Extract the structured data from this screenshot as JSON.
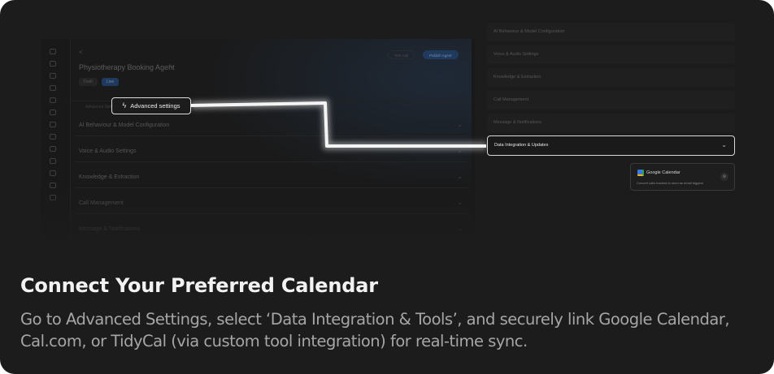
{
  "caption": {
    "title": "Connect Your Preferred Calendar",
    "body": "Go to Advanced Settings, select ‘Data Integration & Tools’, and securely link Google Calendar, Cal.com, or TidyCal (via custom tool integration) for real-time sync."
  },
  "app": {
    "back_label": "<",
    "agent_title": "Physiotherapy Booking Agent",
    "edit_icon": "pencil-icon",
    "tabs": [
      {
        "label": "Draft"
      },
      {
        "label": "Live"
      }
    ],
    "header_buttons": [
      {
        "label": "Test Call"
      },
      {
        "label": "Publish Agent"
      }
    ],
    "advanced_row_label": "Advanced Settings",
    "rail_icons": [
      "home-icon",
      "grid-icon",
      "agents-icon",
      "phone-icon",
      "chart-icon",
      "filter-icon",
      "globe-icon",
      "bolt-icon",
      "phone-call-icon",
      "plus-icon",
      "card-icon",
      "doc-icon",
      "settings-icon"
    ],
    "left_items": [
      {
        "label": "AI Behaviour & Model Configuration"
      },
      {
        "label": "Voice & Audio Settings"
      },
      {
        "label": "Knowledge & Extraction"
      },
      {
        "label": "Call Management"
      },
      {
        "label": "Message & Notifications"
      }
    ]
  },
  "advanced_pill": {
    "label": "Advanced settings",
    "icon": "bolt-icon"
  },
  "settings": {
    "items": [
      {
        "label": "AI Behaviour & Model Configuration"
      },
      {
        "label": "Voice & Audio Settings"
      },
      {
        "label": "Knowledge & Extraction"
      },
      {
        "label": "Call Management"
      },
      {
        "label": "Message & Notifications"
      }
    ],
    "active_item": {
      "label": "Data Integration & Updates",
      "icon": "chevron-down-icon"
    }
  },
  "integration": {
    "name": "Google Calendar",
    "description": "Convert calls tracked to send as email triggers",
    "icon": "google-calendar-icon",
    "action_icon": "gear-icon"
  },
  "colors": {
    "background": "#1c1c1c",
    "highlight": "#ffffff",
    "accent_blue": "#1f3a5c"
  }
}
